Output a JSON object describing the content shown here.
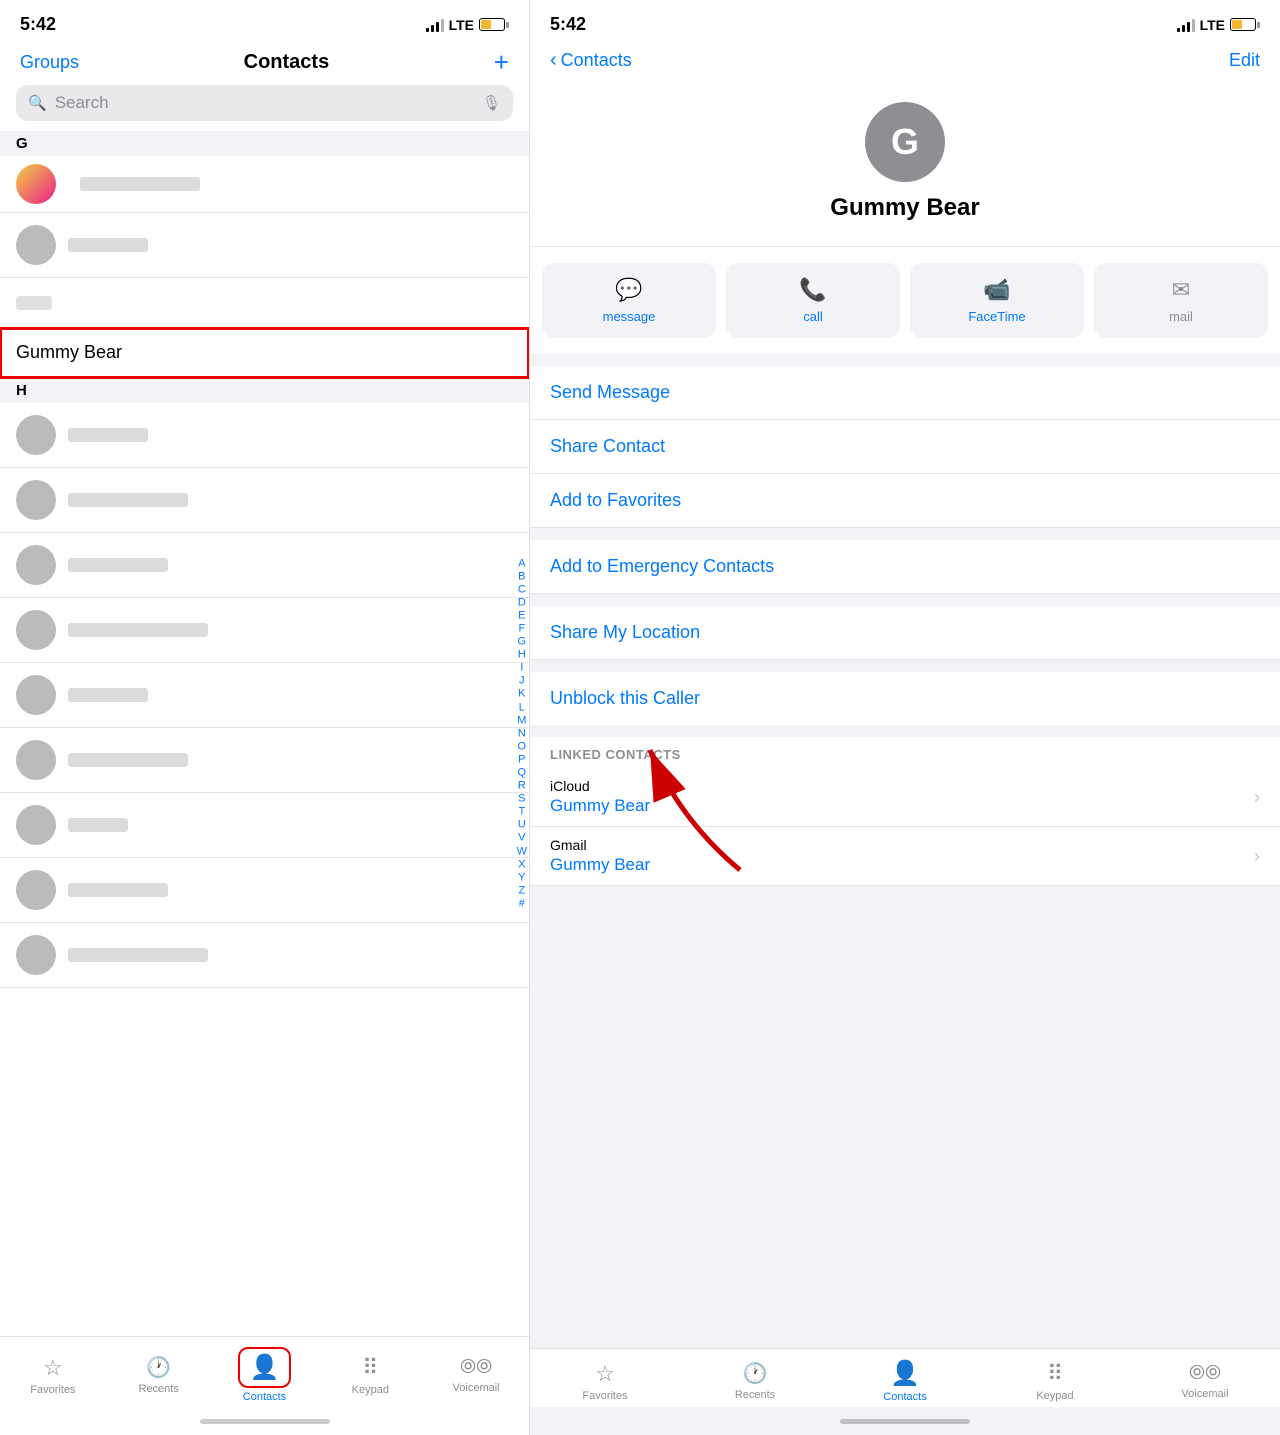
{
  "left": {
    "status": {
      "time": "5:42",
      "lte": "LTE"
    },
    "header": {
      "groups": "Groups",
      "title": "Contacts",
      "add": "+"
    },
    "search": {
      "placeholder": "Search"
    },
    "sections": {
      "g": "G",
      "h": "H"
    },
    "gummy_bear": "Gummy Bear",
    "alphabet": [
      "A",
      "B",
      "C",
      "D",
      "E",
      "F",
      "G",
      "H",
      "I",
      "J",
      "K",
      "L",
      "M",
      "N",
      "O",
      "P",
      "Q",
      "R",
      "S",
      "T",
      "U",
      "V",
      "W",
      "X",
      "Y",
      "Z",
      "#"
    ],
    "tabs": [
      {
        "label": "Favorites",
        "icon": "★"
      },
      {
        "label": "Recents",
        "icon": "🕐"
      },
      {
        "label": "Contacts",
        "icon": "👤",
        "active": true
      },
      {
        "label": "Keypad",
        "icon": "⠿"
      },
      {
        "label": "Voicemail",
        "icon": "⦾"
      }
    ]
  },
  "right": {
    "status": {
      "time": "5:42",
      "lte": "LTE"
    },
    "nav": {
      "back": "Contacts",
      "edit": "Edit"
    },
    "contact": {
      "initial": "G",
      "name": "Gummy Bear"
    },
    "actions": [
      {
        "icon": "💬",
        "label": "message"
      },
      {
        "icon": "📞",
        "label": "call"
      },
      {
        "icon": "📹",
        "label": "FaceTime"
      },
      {
        "icon": "✉",
        "label": "mail",
        "disabled": true
      }
    ],
    "options": [
      {
        "label": "Send Message"
      },
      {
        "label": "Share Contact"
      },
      {
        "label": "Add to Favorites"
      },
      {
        "label": "Add to Emergency Contacts"
      },
      {
        "label": "Share My Location"
      },
      {
        "label": "Unblock this Caller"
      }
    ],
    "linked": {
      "header": "LINKED CONTACTS",
      "items": [
        {
          "source": "iCloud",
          "name": "Gummy Bear"
        },
        {
          "source": "Gmail",
          "name": "Gummy Bear"
        }
      ]
    },
    "tabs": [
      {
        "label": "Favorites",
        "icon": "★"
      },
      {
        "label": "Recents",
        "icon": "🕐"
      },
      {
        "label": "Contacts",
        "icon": "👤",
        "active": true
      },
      {
        "label": "Keypad",
        "icon": "⠿"
      },
      {
        "label": "Voicemail",
        "icon": "⦾"
      }
    ]
  }
}
